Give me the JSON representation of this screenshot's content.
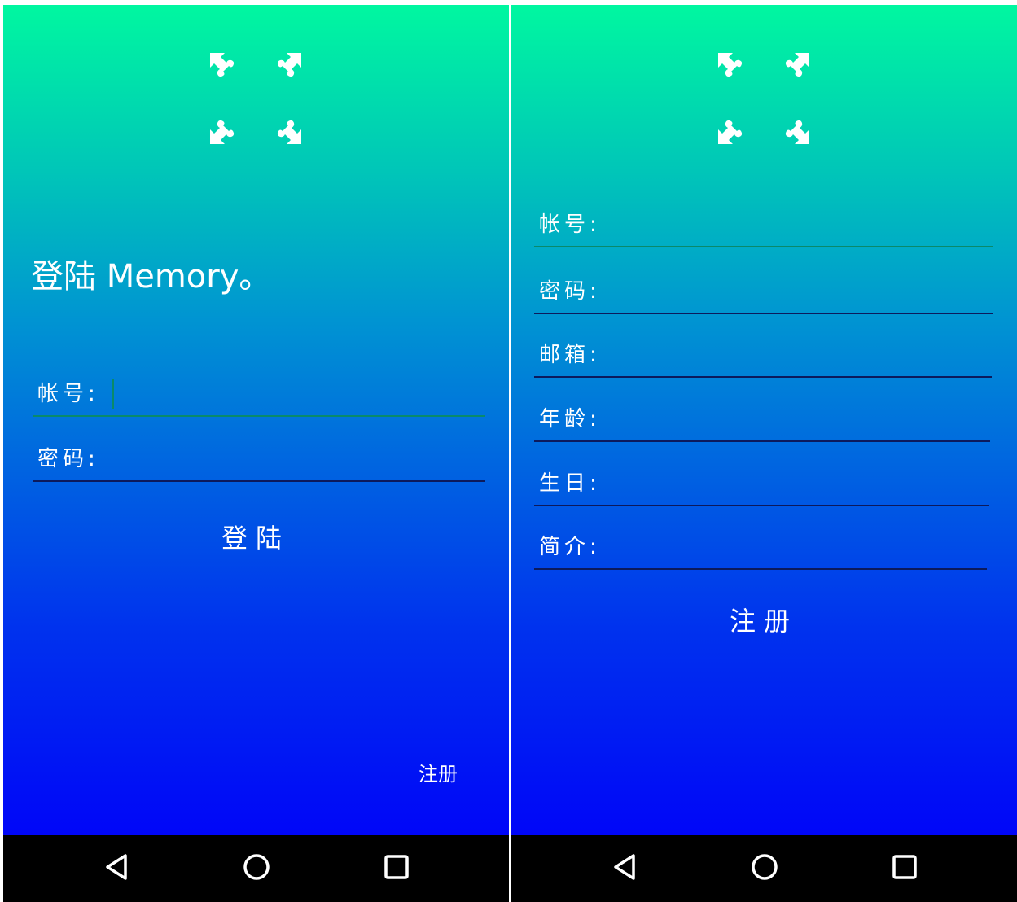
{
  "login_screen": {
    "title": "登陆 Memory。",
    "account_label": "帐号:",
    "password_label": "密码:",
    "login_button": "登陆",
    "register_link": "注册"
  },
  "register_screen": {
    "fields": [
      {
        "label": "帐号:"
      },
      {
        "label": "密码:"
      },
      {
        "label": "邮箱:"
      },
      {
        "label": "年龄:"
      },
      {
        "label": "生日:"
      },
      {
        "label": "简介:"
      }
    ],
    "register_button": "注册"
  },
  "navigation": {
    "icons": [
      "back-icon",
      "home-icon",
      "recents-icon"
    ]
  },
  "colors": {
    "gradient_top": "#00f7a0",
    "gradient_bottom": "#0006f8",
    "focused_underline": "#0a8a6a",
    "underline": "#0c1a5c",
    "text": "#ffffff",
    "navbar": "#000000"
  }
}
